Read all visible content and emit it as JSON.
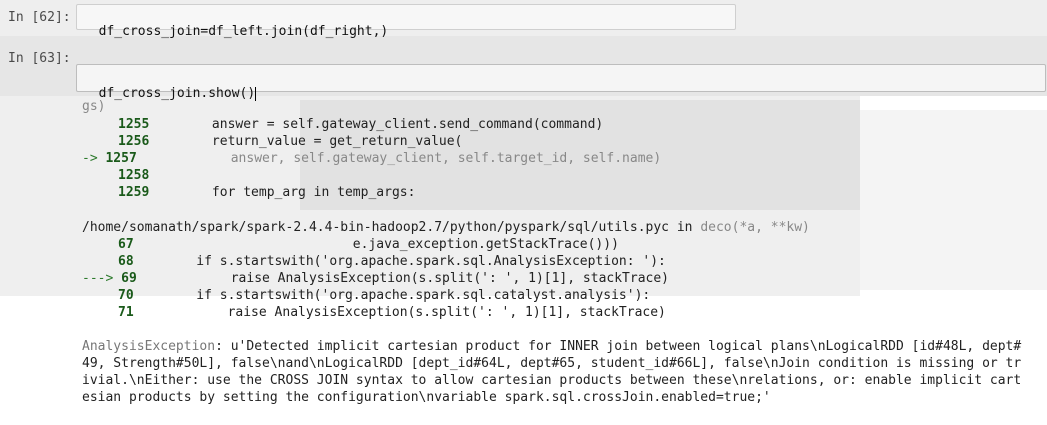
{
  "cells": [
    {
      "prompt": "In [62]:",
      "code": "df_cross_join=df_left.join(df_right,)"
    },
    {
      "prompt": "In [63]:",
      "code": "df_cross_join.show()"
    }
  ],
  "traceback_top": {
    "gs_line": "gs)",
    "lines": [
      {
        "num": "1255",
        "prefix": "",
        "code": "        answer = self.gateway_client.send_command(command)"
      },
      {
        "num": "1256",
        "prefix": "",
        "code": "        return_value = get_return_value("
      },
      {
        "num": "1257",
        "prefix": "-> ",
        "code": "            answer, self.gateway_client, self.target_id, self.name)"
      },
      {
        "num": "1258",
        "prefix": "",
        "code": ""
      },
      {
        "num": "1259",
        "prefix": "",
        "code": "        for temp_arg in temp_args:"
      }
    ]
  },
  "traceback_bottom": {
    "file_path": "/home/somanath/spark/spark-2.4.4-bin-hadoop2.7/python/pyspark/sql/utils.pyc",
    "in_text": " in ",
    "func": "deco(*a, **kw)",
    "lines": [
      {
        "num": "67",
        "prefix": "",
        "code": "                            e.java_exception.getStackTrace()))"
      },
      {
        "num": "68",
        "prefix": "",
        "code": "        if s.startswith('org.apache.spark.sql.AnalysisException: '):"
      },
      {
        "num": "69",
        "prefix": "---> ",
        "code": "            raise AnalysisException(s.split(': ', 1)[1], stackTrace)"
      },
      {
        "num": "70",
        "prefix": "",
        "code": "        if s.startswith('org.apache.spark.sql.catalyst.analysis'):"
      },
      {
        "num": "71",
        "prefix": "",
        "code": "            raise AnalysisException(s.split(': ', 1)[1], stackTrace)"
      }
    ]
  },
  "error": {
    "name": "AnalysisException",
    "lines": [
      ": u'Detected implicit cartesian product for INNER join between logical plans\\nLogicalRDD [id#48L, dept#",
      "49, Strength#50L], false\\nand\\nLogicalRDD [dept_id#64L, dept#65, student_id#66L], false\\nJoin condition is missing or tr",
      "ivial.\\nEither: use the CROSS JOIN syntax to allow cartesian products between these\\nrelations, or: enable implicit cart",
      "esian products by setting the configuration\\nvariable spark.sql.crossJoin.enabled=true;'"
    ]
  }
}
